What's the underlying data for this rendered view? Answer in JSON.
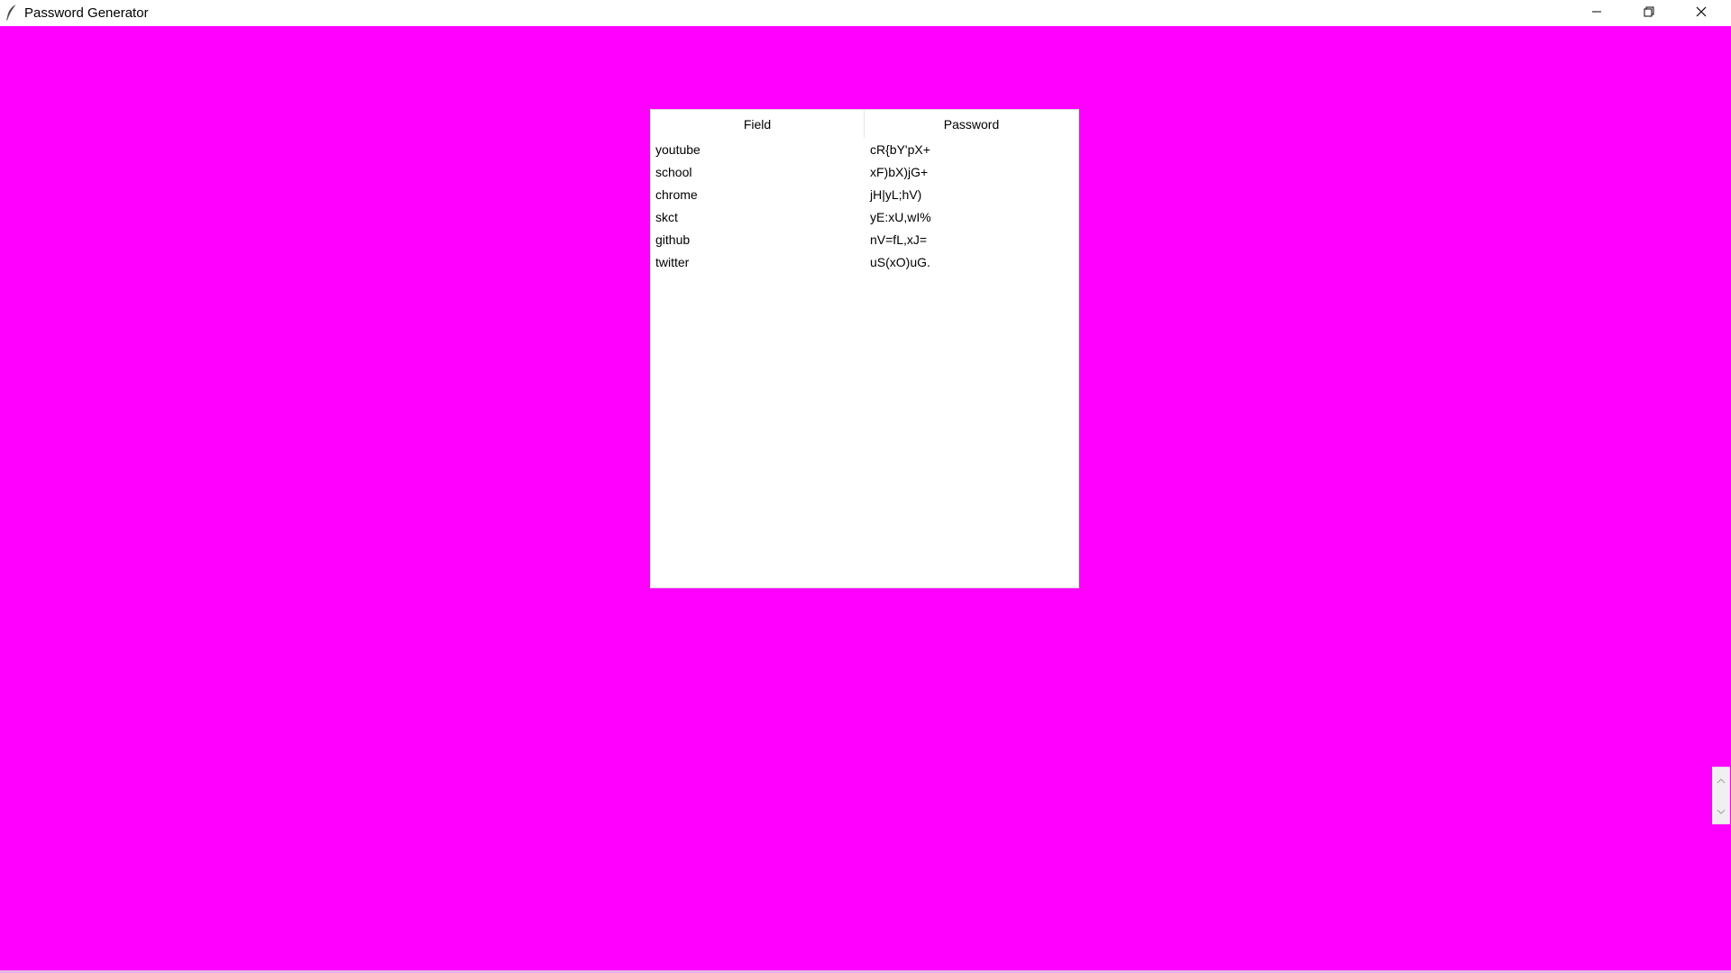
{
  "window": {
    "title": "Password Generator",
    "icon": "feather-icon",
    "controls": {
      "minimize": "minimize-icon",
      "maximize": "restore-icon",
      "close": "close-icon"
    }
  },
  "colors": {
    "background": "#ff00ff",
    "table_bg": "#ffffff",
    "text": "#000000"
  },
  "table": {
    "columns": [
      "Field",
      "Password"
    ],
    "rows": [
      {
        "field": "youtube",
        "password": "cR{bY'pX+"
      },
      {
        "field": "school",
        "password": "xF)bX)jG+"
      },
      {
        "field": "chrome",
        "password": "jH|yL;hV)"
      },
      {
        "field": "skct",
        "password": "yE:xU,wI%"
      },
      {
        "field": "github",
        "password": "nV=fL,xJ="
      },
      {
        "field": "twitter",
        "password": "uS(xO)uG."
      }
    ]
  }
}
